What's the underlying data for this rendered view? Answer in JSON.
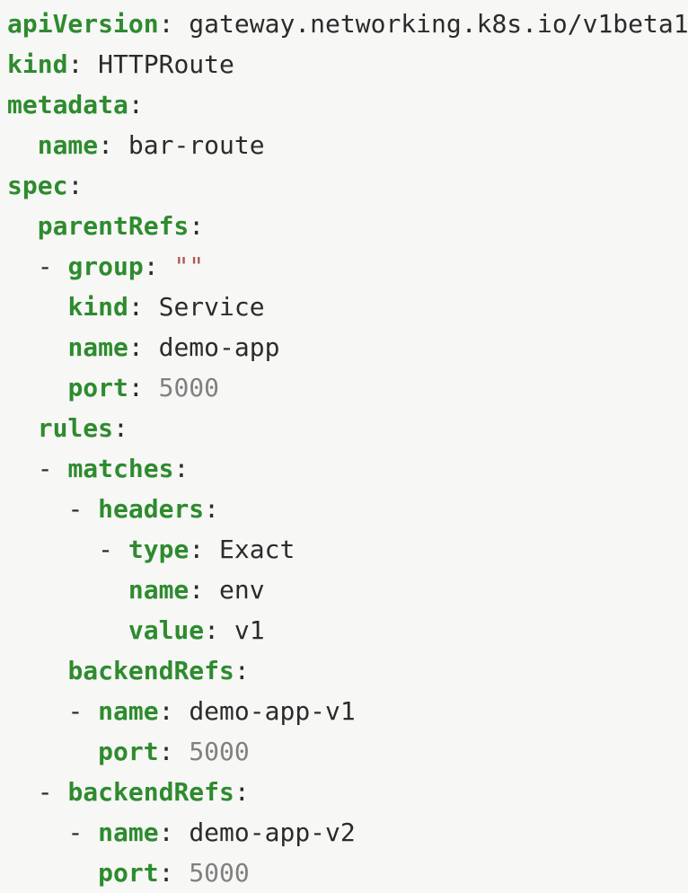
{
  "editor": {
    "language": "yaml",
    "background_color": "#f7f7f6",
    "key_color": "#2e8b2e",
    "value_color": "#2b2b2b",
    "number_color": "#808080",
    "string_color": "#b5535a",
    "punctuation_color": "#2b2b2b"
  },
  "document": {
    "kind": "HTTPRoute",
    "api_version": "gateway.networking.k8s.io/v1beta1",
    "name": "bar-route"
  },
  "lines": [
    {
      "indent": "",
      "dash": "",
      "key": "apiVersion",
      "punct": ": ",
      "value": "gateway.networking.k8s.io/v1beta1",
      "value_type": "plain"
    },
    {
      "indent": "",
      "dash": "",
      "key": "kind",
      "punct": ": ",
      "value": "HTTPRoute",
      "value_type": "plain"
    },
    {
      "indent": "",
      "dash": "",
      "key": "metadata",
      "punct": ":",
      "value": "",
      "value_type": "none"
    },
    {
      "indent": "  ",
      "dash": "",
      "key": "name",
      "punct": ": ",
      "value": "bar-route",
      "value_type": "plain"
    },
    {
      "indent": "",
      "dash": "",
      "key": "spec",
      "punct": ":",
      "value": "",
      "value_type": "none"
    },
    {
      "indent": "  ",
      "dash": "",
      "key": "parentRefs",
      "punct": ":",
      "value": "",
      "value_type": "none"
    },
    {
      "indent": "  ",
      "dash": "- ",
      "key": "group",
      "punct": ": ",
      "value": "\"\"",
      "value_type": "string"
    },
    {
      "indent": "    ",
      "dash": "",
      "key": "kind",
      "punct": ": ",
      "value": "Service",
      "value_type": "plain"
    },
    {
      "indent": "    ",
      "dash": "",
      "key": "name",
      "punct": ": ",
      "value": "demo-app",
      "value_type": "plain"
    },
    {
      "indent": "    ",
      "dash": "",
      "key": "port",
      "punct": ": ",
      "value": "5000",
      "value_type": "number"
    },
    {
      "indent": "  ",
      "dash": "",
      "key": "rules",
      "punct": ":",
      "value": "",
      "value_type": "none"
    },
    {
      "indent": "  ",
      "dash": "- ",
      "key": "matches",
      "punct": ":",
      "value": "",
      "value_type": "none"
    },
    {
      "indent": "    ",
      "dash": "- ",
      "key": "headers",
      "punct": ":",
      "value": "",
      "value_type": "none"
    },
    {
      "indent": "      ",
      "dash": "- ",
      "key": "type",
      "punct": ": ",
      "value": "Exact",
      "value_type": "plain"
    },
    {
      "indent": "        ",
      "dash": "",
      "key": "name",
      "punct": ": ",
      "value": "env",
      "value_type": "plain"
    },
    {
      "indent": "        ",
      "dash": "",
      "key": "value",
      "punct": ": ",
      "value": "v1",
      "value_type": "plain"
    },
    {
      "indent": "    ",
      "dash": "",
      "key": "backendRefs",
      "punct": ":",
      "value": "",
      "value_type": "none"
    },
    {
      "indent": "    ",
      "dash": "- ",
      "key": "name",
      "punct": ": ",
      "value": "demo-app-v1",
      "value_type": "plain"
    },
    {
      "indent": "      ",
      "dash": "",
      "key": "port",
      "punct": ": ",
      "value": "5000",
      "value_type": "number"
    },
    {
      "indent": "  ",
      "dash": "- ",
      "key": "backendRefs",
      "punct": ":",
      "value": "",
      "value_type": "none"
    },
    {
      "indent": "    ",
      "dash": "- ",
      "key": "name",
      "punct": ": ",
      "value": "demo-app-v2",
      "value_type": "plain"
    },
    {
      "indent": "      ",
      "dash": "",
      "key": "port",
      "punct": ": ",
      "value": "5000",
      "value_type": "number"
    }
  ]
}
